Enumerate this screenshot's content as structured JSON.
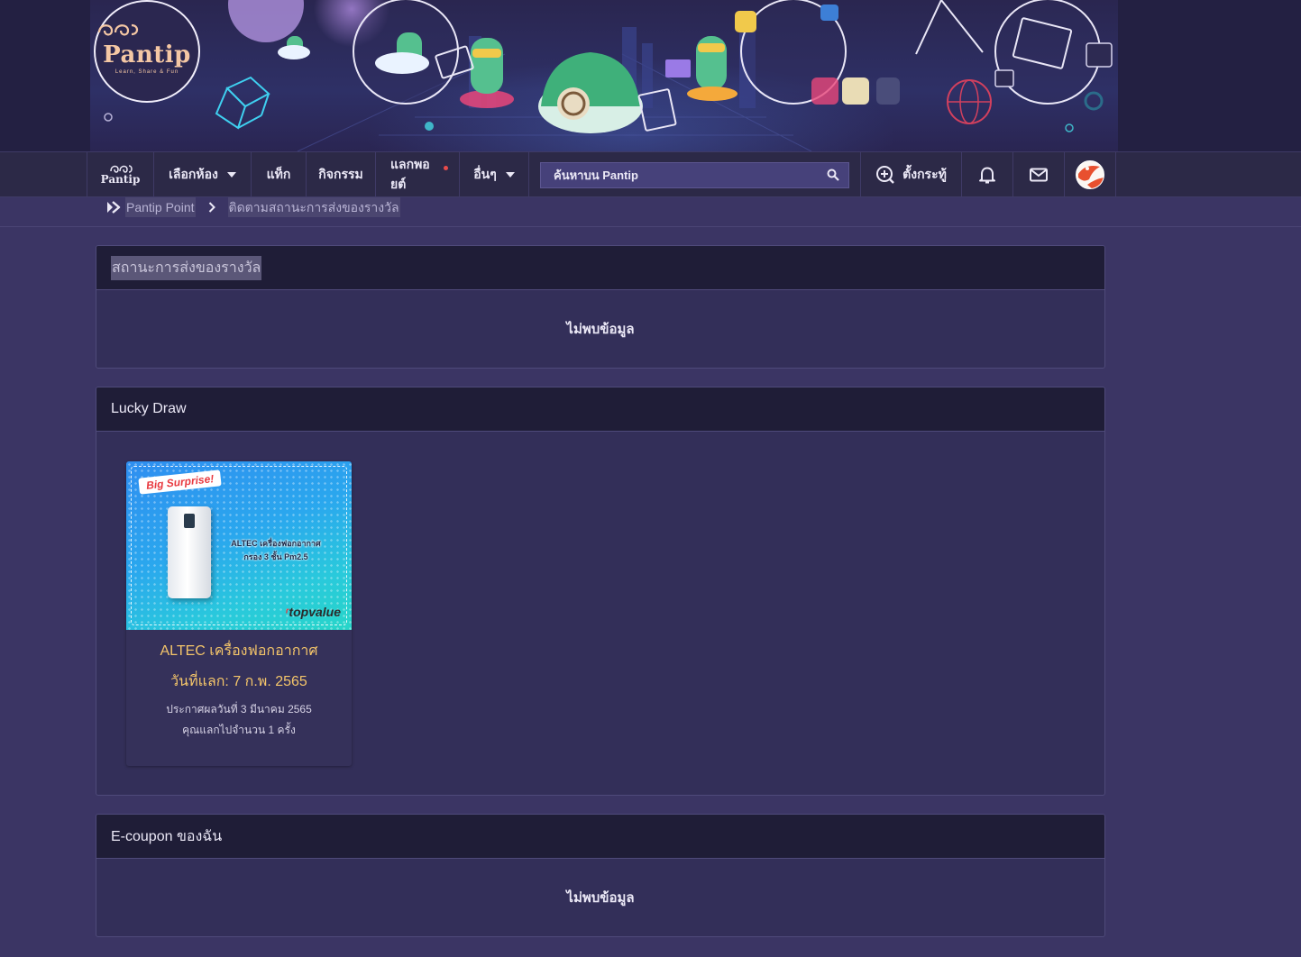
{
  "banner": {
    "logo_text": "Pantip",
    "logo_tagline": "Learn, Share & Fun"
  },
  "nav": {
    "logo_text": "Pantip",
    "items": [
      {
        "label": "เลือกห้อง",
        "has_caret": true
      },
      {
        "label": "แท็ก"
      },
      {
        "label": "กิจกรรม"
      },
      {
        "label": "แลกพอยต์",
        "has_dot": true
      },
      {
        "label": "อื่นๆ",
        "has_caret": true
      }
    ],
    "search_placeholder": "ค้นหาบน Pantip",
    "create_topic_label": "ตั้งกระทู้",
    "icons": [
      "search-icon",
      "create-topic-icon",
      "bell-icon",
      "mail-icon",
      "avatar"
    ]
  },
  "breadcrumb": {
    "items": [
      "Pantip Point",
      "ติดตามสถานะการส่งของรางวัล"
    ]
  },
  "sections": {
    "status": {
      "title": "สถานะการส่งของรางวัล",
      "empty_text": "ไม่พบข้อมูล"
    },
    "lucky_draw": {
      "title": "Lucky Draw",
      "card": {
        "image_badge": "Big Surprise!",
        "image_text_line1": "ALTEC เครื่องฟอกอากาศ",
        "image_text_line2": "กรอง 3 ชั้น Pm2.5",
        "image_brand": "topvalue",
        "title": "ALTEC เครื่องฟอกอากาศ",
        "redeem_date": "วันที่แลก: 7 ก.พ. 2565",
        "announce": "ประกาศผลวันที่ 3 มีนาคม 2565",
        "count": "คุณแลกไปจำนวน 1 ครั้ง"
      }
    },
    "ecoupon": {
      "title": "E-coupon ของฉัน",
      "empty_text": "ไม่พบข้อมูล"
    }
  },
  "colors": {
    "page_bg": "#3b3564",
    "nav_bg": "#2c2947",
    "panel_head_bg": "#1f1d37",
    "card_title": "#f4c56a",
    "notification_dot": "#e94b4b"
  }
}
